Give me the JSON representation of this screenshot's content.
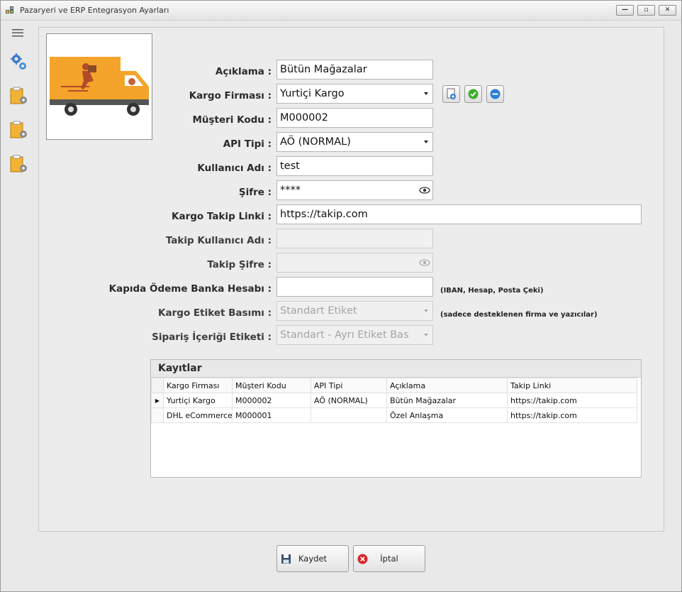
{
  "window": {
    "title": "Pazaryeri ve ERP Entegrasyon Ayarları",
    "min": "—",
    "max": "▫",
    "close": "✕"
  },
  "form": {
    "aciklama": {
      "label": "Açıklama :",
      "value": "Bütün Mağazalar"
    },
    "kargo_firmasi": {
      "label": "Kargo Firması :",
      "value": "Yurtiçi Kargo"
    },
    "musteri_kodu": {
      "label": "Müşteri Kodu :",
      "value": "M000002"
    },
    "api_tipi": {
      "label": "API Tipi :",
      "value": "AÖ (NORMAL)"
    },
    "kullanici_adi": {
      "label": "Kullanıcı Adı :",
      "value": "test"
    },
    "sifre": {
      "label": "Şifre :",
      "value": "****"
    },
    "kargo_takip_linki": {
      "label": "Kargo Takip Linki :",
      "value": "https://takip.com"
    },
    "takip_kullanici_adi": {
      "label": "Takip Kullanıcı Adı :",
      "value": ""
    },
    "takip_sifre": {
      "label": "Takip Şifre :",
      "value": ""
    },
    "kapida_odeme": {
      "label": "Kapıda Ödeme Banka Hesabı :",
      "value": "",
      "hint": "(IBAN, Hesap, Posta Çeki)"
    },
    "kargo_etiket": {
      "label": "Kargo Etiket Basımı :",
      "value": "Standart Etiket",
      "hint": "(sadece desteklenen firma ve yazıcılar)"
    },
    "siparis_icerigi": {
      "label": "Sipariş İçeriği Etiketi :",
      "value": "Standart - Ayrı Etiket Bas"
    }
  },
  "records": {
    "title": "Kayıtlar",
    "columns": [
      "Kargo Firması",
      "Müşteri Kodu",
      "API Tipi",
      "Açıklama",
      "Takip Linki"
    ],
    "rows": [
      {
        "marker": "▶",
        "cells": [
          "Yurtiçi Kargo",
          "M000002",
          "AÖ (NORMAL)",
          "Bütün Mağazalar",
          "https://takip.com"
        ]
      },
      {
        "marker": "",
        "cells": [
          "DHL eCommerce",
          "M000001",
          "",
          "Özel Anlaşma",
          "https://takip.com"
        ]
      }
    ]
  },
  "buttons": {
    "save": "Kaydet",
    "cancel": "İptal"
  },
  "colors": {
    "accent": "#f5a623",
    "truck": "#f4a42a",
    "ok_green": "#3eae2e",
    "remove_blue": "#2a7fd4",
    "cancel_red": "#d9262a"
  }
}
